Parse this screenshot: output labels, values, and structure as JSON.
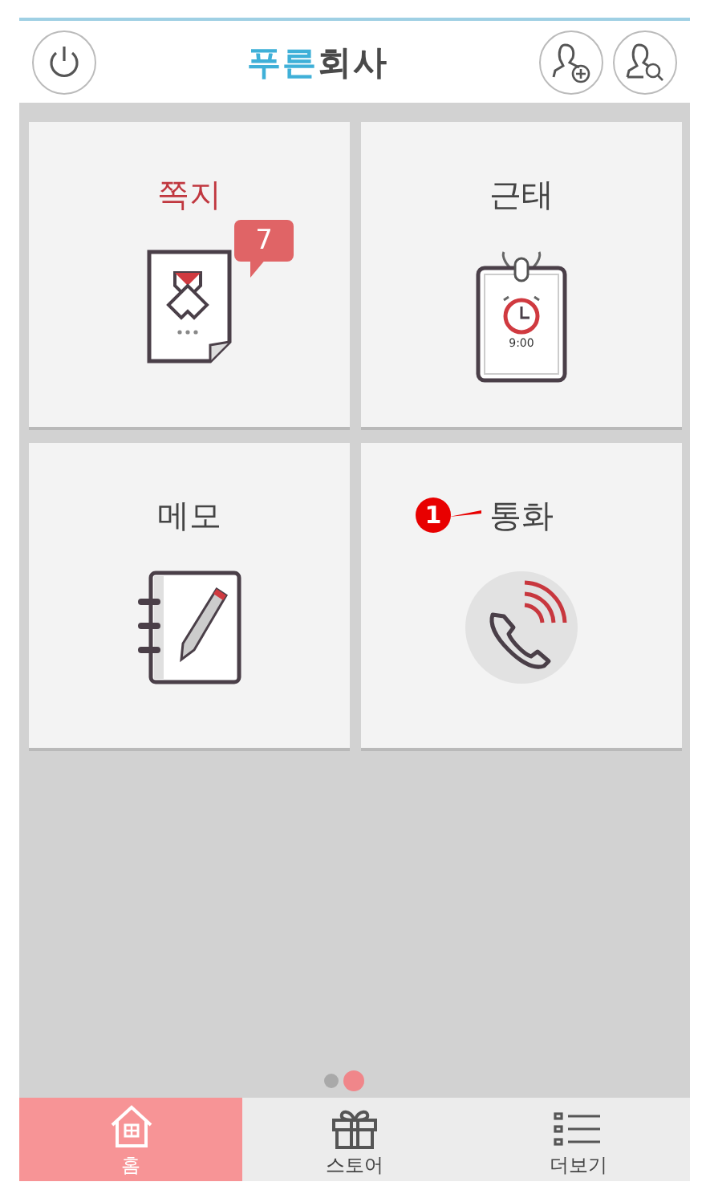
{
  "header": {
    "logo": "푸른회사"
  },
  "tiles": [
    {
      "kind": "message",
      "label": "쪽지",
      "highlighted": true,
      "badge": "7"
    },
    {
      "kind": "attendance",
      "label": "근태",
      "highlighted": false,
      "clock_time": "9:00"
    },
    {
      "kind": "memo",
      "label": "메모",
      "highlighted": false
    },
    {
      "kind": "call",
      "label": "통화",
      "highlighted": false,
      "marker": "1"
    }
  ],
  "pager": [
    {
      "selected": false
    },
    {
      "selected": true
    }
  ],
  "tabs": [
    {
      "kind": "home",
      "label": "홈",
      "selected": true
    },
    {
      "kind": "store",
      "label": "스토어",
      "selected": false
    },
    {
      "kind": "more",
      "label": "더보기",
      "selected": false
    }
  ]
}
